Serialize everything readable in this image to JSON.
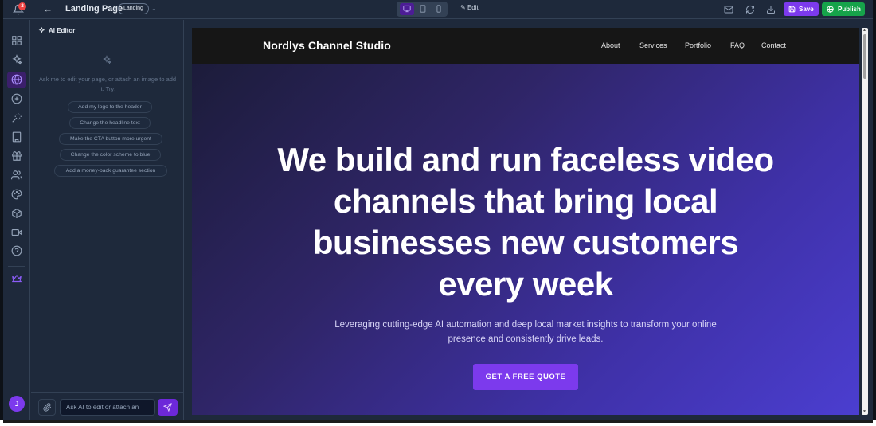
{
  "topbar": {
    "notification_count": "2",
    "page_title": "Landing Page",
    "page_badge": "Landing",
    "edit_label": "Edit",
    "save_label": "Save",
    "publish_label": "Publish",
    "active_device": "desktop"
  },
  "panel": {
    "title": "AI Editor",
    "hint": "Ask me to edit your page, or attach an image to add it. Try:",
    "suggestions": [
      "Add my logo to the header",
      "Change the headline text",
      "Make the CTA button more urgent",
      "Change the color scheme to blue",
      "Add a money-back guarantee section"
    ],
    "input_placeholder": "Ask AI to edit or attach an"
  },
  "rail": {
    "avatar_initial": "J",
    "icons": [
      "grid-icon",
      "sparkles-icon",
      "globe-icon",
      "plus-circle-icon",
      "magic-wand-icon",
      "building-icon",
      "gift-icon",
      "users-icon",
      "palette-icon",
      "box-icon",
      "video-icon",
      "help-icon",
      "crown-icon"
    ],
    "active_item": "globe-icon"
  },
  "site": {
    "brand": "Nordlys Channel Studio",
    "nav": [
      "About",
      "Services",
      "Portfolio",
      "FAQ",
      "Contact"
    ],
    "hero_title": "We build and run faceless video channels that bring local businesses new customers every week",
    "hero_subtitle": "Leveraging cutting-edge AI automation and deep local market insights to transform your online presence and consistently drive leads.",
    "cta_label": "GET A FREE QUOTE"
  },
  "colors": {
    "accent": "#7c3aed",
    "publish": "#16a34a",
    "badge": "#ef4444",
    "hero_gradient_start": "#1c1c3a",
    "hero_gradient_end": "#4b3ed0"
  }
}
